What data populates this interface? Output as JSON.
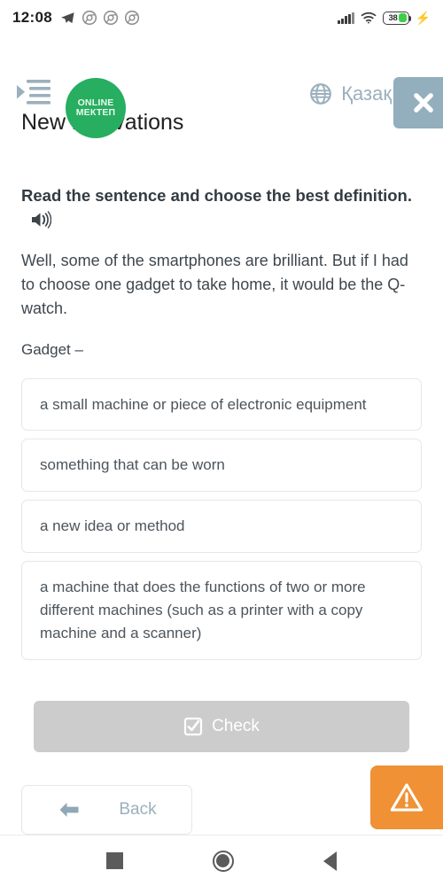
{
  "status_bar": {
    "time": "12:08",
    "left_icons": [
      "telegram-icon",
      "chrome-icon",
      "chrome-icon",
      "chrome-icon"
    ],
    "signal_icon": "cellular-signal-icon",
    "wifi_icon": "wifi-icon",
    "battery_percent": "38",
    "charging_icon": "charging-bolt-icon"
  },
  "header": {
    "menu_icon": "indent-list-icon",
    "logo_line1": "ONLINE",
    "logo_line2": "МЕКТЕП",
    "globe_icon": "globe-icon",
    "language": "Қазақ",
    "close_icon": "close-icon"
  },
  "page": {
    "title": "New innovations",
    "prompt": "Read the sentence and choose the best definition.",
    "speaker_icon": "speaker-icon",
    "passage": "Well, some of the smartphones are brilliant. But if I had to choose one gadget to take home, it would be the Q-watch.",
    "lead_in": "Gadget –"
  },
  "options": [
    "a small machine or piece of electronic equipment",
    "something that can be worn",
    "a new idea or method",
    "a machine that does the functions of two or more different machines (such as a printer with a copy machine and a scanner)"
  ],
  "actions": {
    "check_label": "Check",
    "check_icon": "checkbox-icon",
    "back_label": "Back",
    "back_icon": "arrow-left-icon",
    "report_icon": "warning-triangle-icon"
  },
  "nav_bar": {
    "recents_icon": "square-recents-icon",
    "home_icon": "circle-home-icon",
    "back_icon": "triangle-back-icon"
  },
  "colors": {
    "brand_green": "#27ae60",
    "accent_orange": "#ef9134",
    "muted_blue_grey": "#93aebd",
    "disabled_grey": "#cccccc"
  }
}
